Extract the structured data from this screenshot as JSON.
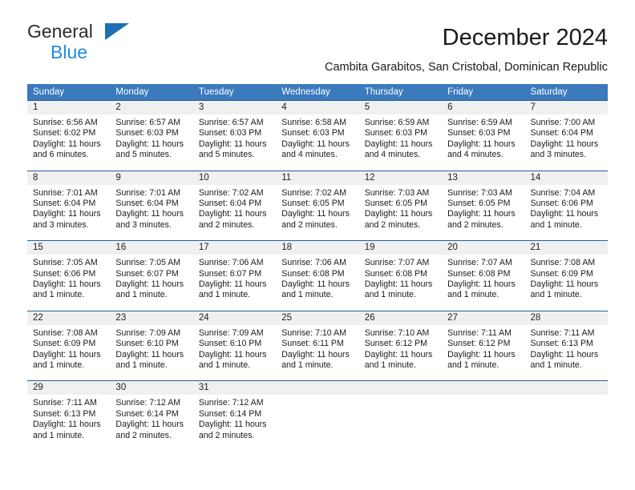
{
  "logo": {
    "word_one": "General",
    "word_two": "Blue",
    "triangle_icon": "triangle-icon",
    "brand_dark": "#2b2b2b",
    "brand_blue": "#1f8ae0",
    "triangle_color": "#1f6fb5"
  },
  "header": {
    "title": "December 2024",
    "subtitle": "Cambita Garabitos, San Cristobal, Dominican Republic"
  },
  "colors": {
    "header_row_bg": "#3a7abd",
    "week_divider": "#215f99",
    "day_number_bg": "#f0f0f0",
    "text": "#1b1b1b"
  },
  "calendar": {
    "weekdays": [
      "Sunday",
      "Monday",
      "Tuesday",
      "Wednesday",
      "Thursday",
      "Friday",
      "Saturday"
    ],
    "labels": {
      "sunrise": "Sunrise:",
      "sunset": "Sunset:",
      "daylight": "Daylight:"
    },
    "weeks": [
      [
        {
          "day": "1",
          "sunrise": "Sunrise: 6:56 AM",
          "sunset": "Sunset: 6:02 PM",
          "daylight_line1": "Daylight: 11 hours",
          "daylight_line2": "and 6 minutes."
        },
        {
          "day": "2",
          "sunrise": "Sunrise: 6:57 AM",
          "sunset": "Sunset: 6:03 PM",
          "daylight_line1": "Daylight: 11 hours",
          "daylight_line2": "and 5 minutes."
        },
        {
          "day": "3",
          "sunrise": "Sunrise: 6:57 AM",
          "sunset": "Sunset: 6:03 PM",
          "daylight_line1": "Daylight: 11 hours",
          "daylight_line2": "and 5 minutes."
        },
        {
          "day": "4",
          "sunrise": "Sunrise: 6:58 AM",
          "sunset": "Sunset: 6:03 PM",
          "daylight_line1": "Daylight: 11 hours",
          "daylight_line2": "and 4 minutes."
        },
        {
          "day": "5",
          "sunrise": "Sunrise: 6:59 AM",
          "sunset": "Sunset: 6:03 PM",
          "daylight_line1": "Daylight: 11 hours",
          "daylight_line2": "and 4 minutes."
        },
        {
          "day": "6",
          "sunrise": "Sunrise: 6:59 AM",
          "sunset": "Sunset: 6:03 PM",
          "daylight_line1": "Daylight: 11 hours",
          "daylight_line2": "and 4 minutes."
        },
        {
          "day": "7",
          "sunrise": "Sunrise: 7:00 AM",
          "sunset": "Sunset: 6:04 PM",
          "daylight_line1": "Daylight: 11 hours",
          "daylight_line2": "and 3 minutes."
        }
      ],
      [
        {
          "day": "8",
          "sunrise": "Sunrise: 7:01 AM",
          "sunset": "Sunset: 6:04 PM",
          "daylight_line1": "Daylight: 11 hours",
          "daylight_line2": "and 3 minutes."
        },
        {
          "day": "9",
          "sunrise": "Sunrise: 7:01 AM",
          "sunset": "Sunset: 6:04 PM",
          "daylight_line1": "Daylight: 11 hours",
          "daylight_line2": "and 3 minutes."
        },
        {
          "day": "10",
          "sunrise": "Sunrise: 7:02 AM",
          "sunset": "Sunset: 6:04 PM",
          "daylight_line1": "Daylight: 11 hours",
          "daylight_line2": "and 2 minutes."
        },
        {
          "day": "11",
          "sunrise": "Sunrise: 7:02 AM",
          "sunset": "Sunset: 6:05 PM",
          "daylight_line1": "Daylight: 11 hours",
          "daylight_line2": "and 2 minutes."
        },
        {
          "day": "12",
          "sunrise": "Sunrise: 7:03 AM",
          "sunset": "Sunset: 6:05 PM",
          "daylight_line1": "Daylight: 11 hours",
          "daylight_line2": "and 2 minutes."
        },
        {
          "day": "13",
          "sunrise": "Sunrise: 7:03 AM",
          "sunset": "Sunset: 6:05 PM",
          "daylight_line1": "Daylight: 11 hours",
          "daylight_line2": "and 2 minutes."
        },
        {
          "day": "14",
          "sunrise": "Sunrise: 7:04 AM",
          "sunset": "Sunset: 6:06 PM",
          "daylight_line1": "Daylight: 11 hours",
          "daylight_line2": "and 1 minute."
        }
      ],
      [
        {
          "day": "15",
          "sunrise": "Sunrise: 7:05 AM",
          "sunset": "Sunset: 6:06 PM",
          "daylight_line1": "Daylight: 11 hours",
          "daylight_line2": "and 1 minute."
        },
        {
          "day": "16",
          "sunrise": "Sunrise: 7:05 AM",
          "sunset": "Sunset: 6:07 PM",
          "daylight_line1": "Daylight: 11 hours",
          "daylight_line2": "and 1 minute."
        },
        {
          "day": "17",
          "sunrise": "Sunrise: 7:06 AM",
          "sunset": "Sunset: 6:07 PM",
          "daylight_line1": "Daylight: 11 hours",
          "daylight_line2": "and 1 minute."
        },
        {
          "day": "18",
          "sunrise": "Sunrise: 7:06 AM",
          "sunset": "Sunset: 6:08 PM",
          "daylight_line1": "Daylight: 11 hours",
          "daylight_line2": "and 1 minute."
        },
        {
          "day": "19",
          "sunrise": "Sunrise: 7:07 AM",
          "sunset": "Sunset: 6:08 PM",
          "daylight_line1": "Daylight: 11 hours",
          "daylight_line2": "and 1 minute."
        },
        {
          "day": "20",
          "sunrise": "Sunrise: 7:07 AM",
          "sunset": "Sunset: 6:08 PM",
          "daylight_line1": "Daylight: 11 hours",
          "daylight_line2": "and 1 minute."
        },
        {
          "day": "21",
          "sunrise": "Sunrise: 7:08 AM",
          "sunset": "Sunset: 6:09 PM",
          "daylight_line1": "Daylight: 11 hours",
          "daylight_line2": "and 1 minute."
        }
      ],
      [
        {
          "day": "22",
          "sunrise": "Sunrise: 7:08 AM",
          "sunset": "Sunset: 6:09 PM",
          "daylight_line1": "Daylight: 11 hours",
          "daylight_line2": "and 1 minute."
        },
        {
          "day": "23",
          "sunrise": "Sunrise: 7:09 AM",
          "sunset": "Sunset: 6:10 PM",
          "daylight_line1": "Daylight: 11 hours",
          "daylight_line2": "and 1 minute."
        },
        {
          "day": "24",
          "sunrise": "Sunrise: 7:09 AM",
          "sunset": "Sunset: 6:10 PM",
          "daylight_line1": "Daylight: 11 hours",
          "daylight_line2": "and 1 minute."
        },
        {
          "day": "25",
          "sunrise": "Sunrise: 7:10 AM",
          "sunset": "Sunset: 6:11 PM",
          "daylight_line1": "Daylight: 11 hours",
          "daylight_line2": "and 1 minute."
        },
        {
          "day": "26",
          "sunrise": "Sunrise: 7:10 AM",
          "sunset": "Sunset: 6:12 PM",
          "daylight_line1": "Daylight: 11 hours",
          "daylight_line2": "and 1 minute."
        },
        {
          "day": "27",
          "sunrise": "Sunrise: 7:11 AM",
          "sunset": "Sunset: 6:12 PM",
          "daylight_line1": "Daylight: 11 hours",
          "daylight_line2": "and 1 minute."
        },
        {
          "day": "28",
          "sunrise": "Sunrise: 7:11 AM",
          "sunset": "Sunset: 6:13 PM",
          "daylight_line1": "Daylight: 11 hours",
          "daylight_line2": "and 1 minute."
        }
      ],
      [
        {
          "day": "29",
          "sunrise": "Sunrise: 7:11 AM",
          "sunset": "Sunset: 6:13 PM",
          "daylight_line1": "Daylight: 11 hours",
          "daylight_line2": "and 1 minute."
        },
        {
          "day": "30",
          "sunrise": "Sunrise: 7:12 AM",
          "sunset": "Sunset: 6:14 PM",
          "daylight_line1": "Daylight: 11 hours",
          "daylight_line2": "and 2 minutes."
        },
        {
          "day": "31",
          "sunrise": "Sunrise: 7:12 AM",
          "sunset": "Sunset: 6:14 PM",
          "daylight_line1": "Daylight: 11 hours",
          "daylight_line2": "and 2 minutes."
        },
        {
          "day": "",
          "sunrise": "",
          "sunset": "",
          "daylight_line1": "",
          "daylight_line2": ""
        },
        {
          "day": "",
          "sunrise": "",
          "sunset": "",
          "daylight_line1": "",
          "daylight_line2": ""
        },
        {
          "day": "",
          "sunrise": "",
          "sunset": "",
          "daylight_line1": "",
          "daylight_line2": ""
        },
        {
          "day": "",
          "sunrise": "",
          "sunset": "",
          "daylight_line1": "",
          "daylight_line2": ""
        }
      ]
    ]
  }
}
